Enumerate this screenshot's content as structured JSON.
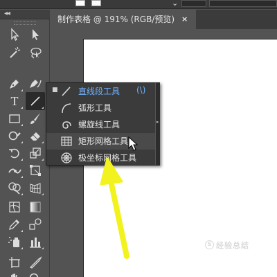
{
  "document_tab": {
    "title": "制作表格 @ 191% (RGB/预览)",
    "close": "×"
  },
  "toolbar_top": {
    "collapse_glyph": "⋘",
    "chevron": "⌄"
  },
  "tools_panel": {
    "collapse_label": "◂◂",
    "tools": [
      {
        "icon": "selection-arrow-icon"
      },
      {
        "icon": "direct-selection-arrow-icon"
      },
      {
        "icon": "magic-wand-icon"
      },
      {
        "icon": "lasso-icon"
      },
      {
        "icon": "pen-icon"
      },
      {
        "icon": "curvature-pen-icon"
      },
      {
        "icon": "type-icon",
        "label": "T"
      },
      {
        "icon": "line-segment-icon",
        "active": true
      },
      {
        "icon": "rectangle-icon"
      },
      {
        "icon": "paintbrush-icon"
      },
      {
        "icon": "shaper-icon"
      },
      {
        "icon": "eraser-icon"
      },
      {
        "icon": "rotate-icon"
      },
      {
        "icon": "scale-icon"
      },
      {
        "icon": "width-icon"
      },
      {
        "icon": "free-transform-icon"
      },
      {
        "icon": "shape-builder-icon"
      },
      {
        "icon": "perspective-grid-icon"
      },
      {
        "icon": "mesh-icon"
      },
      {
        "icon": "gradient-icon"
      },
      {
        "icon": "eyedropper-icon"
      },
      {
        "icon": "blend-icon"
      },
      {
        "icon": "symbol-sprayer-icon"
      },
      {
        "icon": "column-graph-icon"
      },
      {
        "icon": "artboard-icon"
      },
      {
        "icon": "slice-icon"
      },
      {
        "icon": "hand-icon"
      },
      {
        "icon": "zoom-icon"
      }
    ]
  },
  "flyout_menu": {
    "items": [
      {
        "icon": "line-segment-icon",
        "label": "直线段工具",
        "shortcut": "(\\)",
        "selected": true
      },
      {
        "icon": "arc-icon",
        "label": "弧形工具"
      },
      {
        "icon": "spiral-icon",
        "label": "螺旋线工具"
      },
      {
        "icon": "rectangular-grid-icon",
        "label": "矩形网格工具",
        "hovered": true
      },
      {
        "icon": "polar-grid-icon",
        "label": "极坐标网格工具"
      }
    ],
    "selected_marker": "■",
    "tearoff_glyph": "▸"
  },
  "colors": {
    "accent": "#6fb2ff",
    "arrow": "#f2f21e",
    "panel": "#535353",
    "menu": "#3b3b3b"
  },
  "watermark": {
    "text": "经验总结",
    "icon": "search-icon"
  }
}
